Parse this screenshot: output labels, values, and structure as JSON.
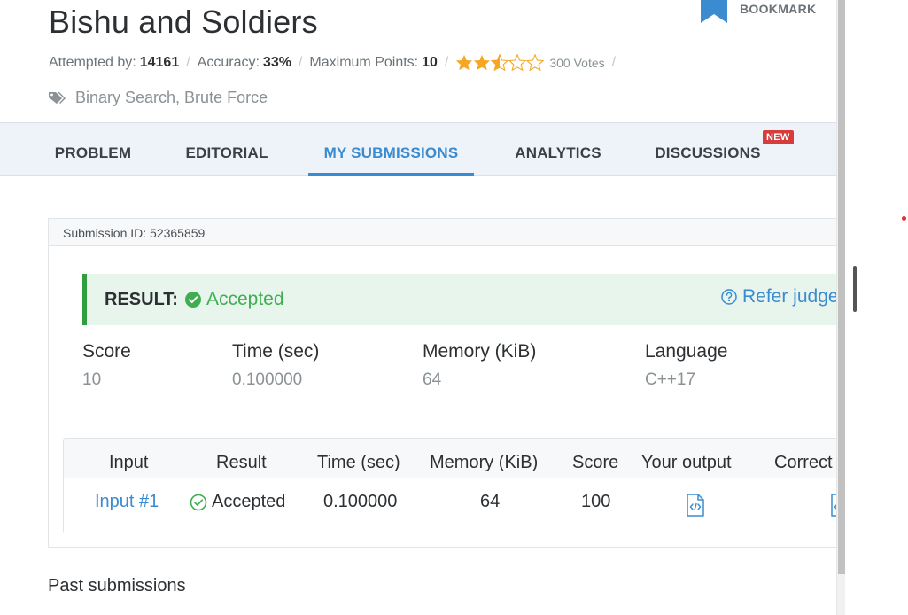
{
  "problem": {
    "title": "Bishu and Soldiers",
    "bookmark_label": "BOOKMARK",
    "attempted_label": "Attempted by:",
    "attempted_value": "14161",
    "accuracy_label": "Accuracy:",
    "accuracy_value": "33%",
    "max_points_label": "Maximum Points:",
    "max_points_value": "10",
    "rating": {
      "value": 2.5,
      "out_of": 5
    },
    "votes": "300 Votes",
    "tags": "Binary Search, Brute Force"
  },
  "tabs": [
    {
      "label": "PROBLEM",
      "active": false
    },
    {
      "label": "EDITORIAL",
      "active": false
    },
    {
      "label": "MY SUBMISSIONS",
      "active": true
    },
    {
      "label": "ANALYTICS",
      "active": false
    },
    {
      "label": "DISCUSSIONS",
      "active": false
    }
  ],
  "new_badge": "NEW",
  "submission": {
    "id_label": "Submission ID: 52365859",
    "result_label": "RESULT:",
    "result_status": "Accepted",
    "refer_label": "Refer judge",
    "stats": [
      {
        "label": "Score",
        "value": "10"
      },
      {
        "label": "Time (sec)",
        "value": "0.100000"
      },
      {
        "label": "Memory (KiB)",
        "value": "64"
      },
      {
        "label": "Language",
        "value": "C++17"
      }
    ],
    "testcases": {
      "headers": [
        "Input",
        "Result",
        "Time (sec)",
        "Memory (KiB)",
        "Score",
        "Your output",
        "Correct"
      ],
      "rows": [
        {
          "input": "Input #1",
          "result": "Accepted",
          "time": "0.100000",
          "memory": "64",
          "score": "100"
        }
      ]
    }
  },
  "past_submissions_label": "Past submissions",
  "colors": {
    "accent": "#3a8bd0",
    "success": "#3fae51",
    "success_bar": "#2e9e3e",
    "star": "#f5a623",
    "badge": "#d63c3c"
  },
  "icons": [
    "bookmark-icon",
    "tag-icon",
    "check-circle-icon",
    "help-circle-icon",
    "code-file-icon"
  ]
}
